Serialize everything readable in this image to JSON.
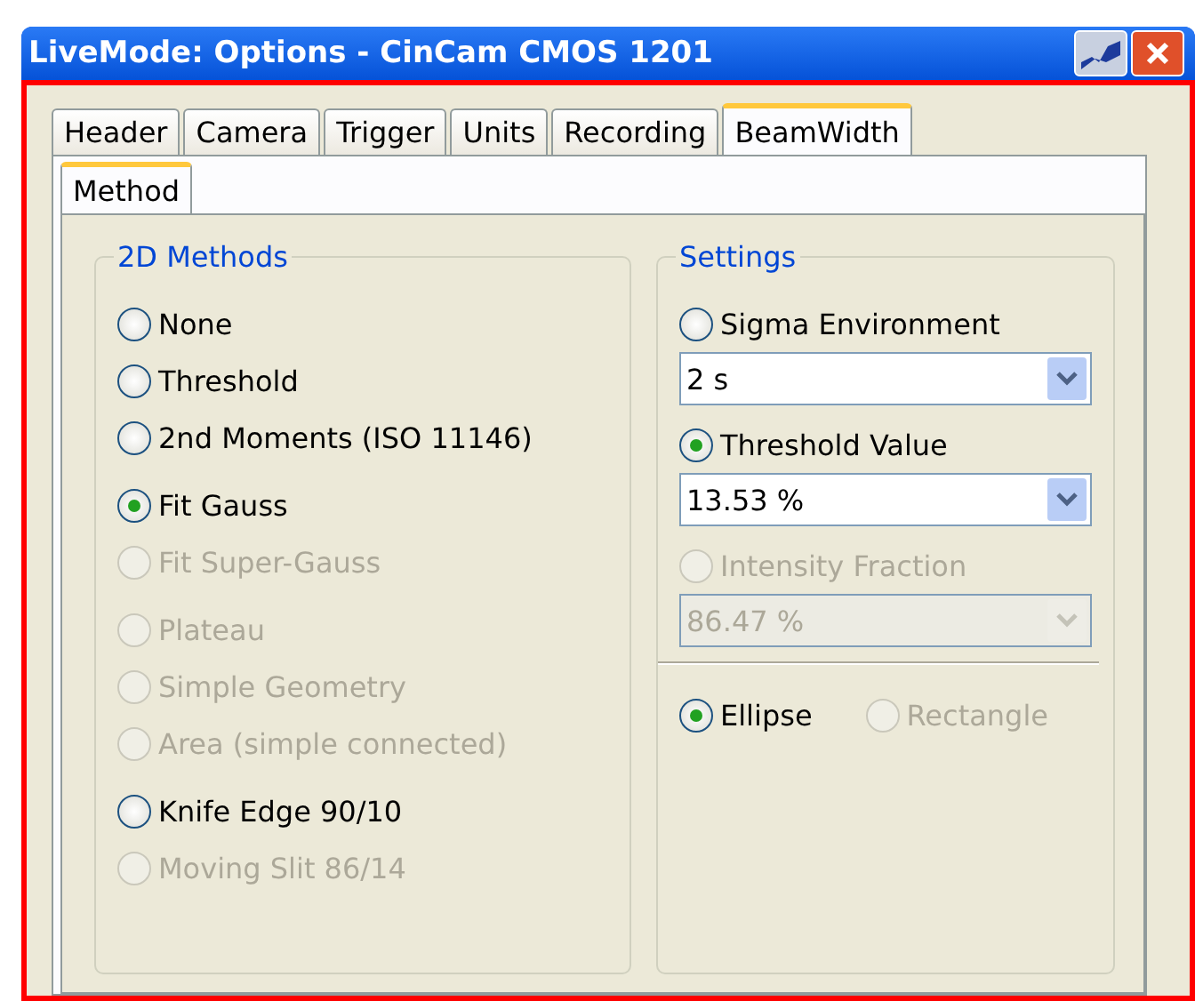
{
  "window": {
    "title": "LiveMode: Options - CinCam CMOS 1201"
  },
  "tabs": [
    {
      "label": "Header",
      "selected": false
    },
    {
      "label": "Camera",
      "selected": false
    },
    {
      "label": "Trigger",
      "selected": false
    },
    {
      "label": "Units",
      "selected": false
    },
    {
      "label": "Recording",
      "selected": false
    },
    {
      "label": "BeamWidth",
      "selected": true
    }
  ],
  "subtabs": [
    {
      "label": "Method",
      "selected": true
    }
  ],
  "methods": {
    "title": "2D Methods",
    "groups": [
      [
        {
          "label": "None",
          "selected": false,
          "disabled": false
        },
        {
          "label": "Threshold",
          "selected": false,
          "disabled": false
        },
        {
          "label": "2nd Moments (ISO 11146)",
          "selected": false,
          "disabled": false
        }
      ],
      [
        {
          "label": "Fit Gauss",
          "selected": true,
          "disabled": false
        },
        {
          "label": "Fit Super-Gauss",
          "selected": false,
          "disabled": true
        }
      ],
      [
        {
          "label": "Plateau",
          "selected": false,
          "disabled": true
        },
        {
          "label": "Simple Geometry",
          "selected": false,
          "disabled": true
        },
        {
          "label": "Area (simple connected)",
          "selected": false,
          "disabled": true
        }
      ],
      [
        {
          "label": "Knife Edge 90/10",
          "selected": false,
          "disabled": false
        },
        {
          "label": "Moving Slit 86/14",
          "selected": false,
          "disabled": true
        }
      ]
    ]
  },
  "settings": {
    "title": "Settings",
    "items": [
      {
        "kind": "radio",
        "label": "Sigma Environment",
        "selected": false,
        "disabled": false
      },
      {
        "kind": "dropdown",
        "value": "2 s",
        "disabled": false
      },
      {
        "kind": "radio",
        "label": "Threshold Value",
        "selected": true,
        "disabled": false
      },
      {
        "kind": "dropdown",
        "value": "13.53 %",
        "disabled": false
      },
      {
        "kind": "radio",
        "label": "Intensity Fraction",
        "selected": false,
        "disabled": true
      },
      {
        "kind": "dropdown",
        "value": "86.47 %",
        "disabled": true
      }
    ],
    "shapes": [
      {
        "label": "Ellipse",
        "selected": true,
        "disabled": false
      },
      {
        "label": "Rectangle",
        "selected": false,
        "disabled": true
      }
    ]
  }
}
